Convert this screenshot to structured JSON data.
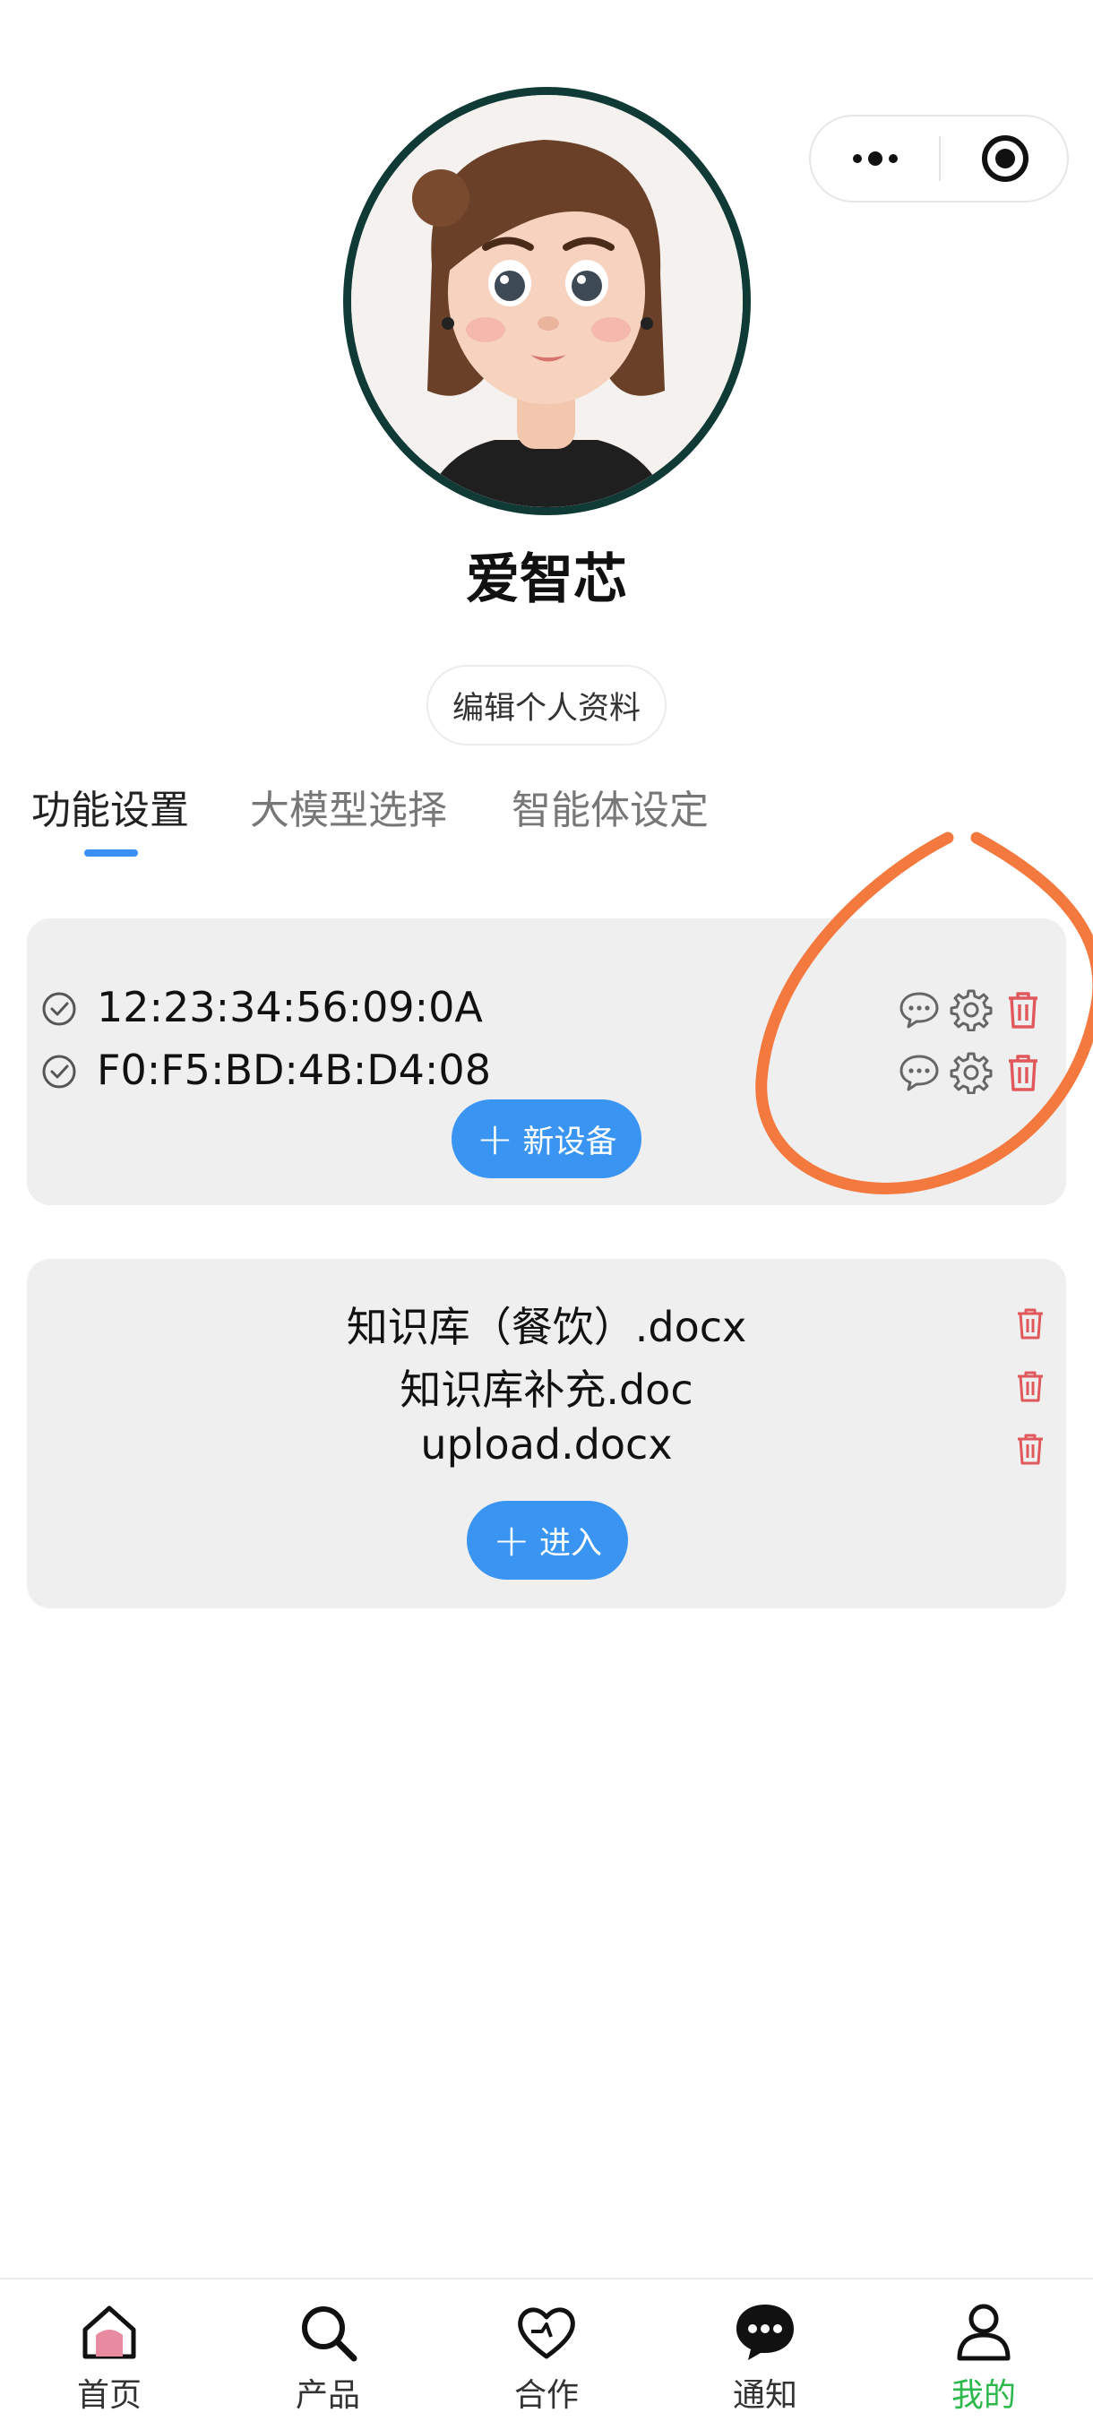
{
  "profile": {
    "nickname": "爱智芯",
    "edit_label": "编辑个人资料"
  },
  "tabs": [
    {
      "label": "功能设置",
      "active": true
    },
    {
      "label": "大模型选择",
      "active": false
    },
    {
      "label": "智能体设定",
      "active": false
    }
  ],
  "devices": {
    "items": [
      {
        "mac": "12:23:34:56:09:0A"
      },
      {
        "mac": "F0:F5:BD:4B:D4:08"
      }
    ],
    "add_label": "新设备",
    "add_icon": "plus"
  },
  "knowledge": {
    "files": [
      "知识库（餐饮）.docx",
      "知识库补充.doc",
      "upload.docx"
    ],
    "enter_label": "进入",
    "enter_icon": "plus"
  },
  "tabbar": [
    {
      "label": "首页",
      "icon": "home-icon",
      "active": false
    },
    {
      "label": "产品",
      "icon": "search-icon",
      "active": false
    },
    {
      "label": "合作",
      "icon": "heart-icon",
      "active": false
    },
    {
      "label": "通知",
      "icon": "chat-bubble-icon",
      "active": false
    },
    {
      "label": "我的",
      "icon": "user-icon",
      "active": true
    }
  ],
  "colors": {
    "accent": "#3a95f2",
    "active_tab": "#2db84d",
    "delete": "#e0585b",
    "annotation": "#f4793f"
  }
}
